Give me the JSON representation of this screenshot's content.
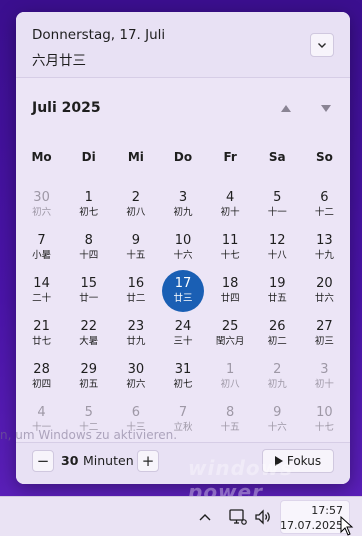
{
  "header": {
    "date": "Donnerstag, 17. Juli",
    "lunar": "六月廿三"
  },
  "calendar": {
    "month_label": "Juli 2025",
    "weekdays": [
      "Mo",
      "Di",
      "Mi",
      "Do",
      "Fr",
      "Sa",
      "So"
    ],
    "days": [
      {
        "n": "30",
        "l": "初六",
        "other": true
      },
      {
        "n": "1",
        "l": "初七"
      },
      {
        "n": "2",
        "l": "初八"
      },
      {
        "n": "3",
        "l": "初九"
      },
      {
        "n": "4",
        "l": "初十"
      },
      {
        "n": "5",
        "l": "十一"
      },
      {
        "n": "6",
        "l": "十二"
      },
      {
        "n": "7",
        "l": "小暑"
      },
      {
        "n": "8",
        "l": "十四"
      },
      {
        "n": "9",
        "l": "十五"
      },
      {
        "n": "10",
        "l": "十六"
      },
      {
        "n": "11",
        "l": "十七"
      },
      {
        "n": "12",
        "l": "十八"
      },
      {
        "n": "13",
        "l": "十九"
      },
      {
        "n": "14",
        "l": "二十"
      },
      {
        "n": "15",
        "l": "廿一"
      },
      {
        "n": "16",
        "l": "廿二"
      },
      {
        "n": "17",
        "l": "廿三",
        "today": true
      },
      {
        "n": "18",
        "l": "廿四"
      },
      {
        "n": "19",
        "l": "廿五"
      },
      {
        "n": "20",
        "l": "廿六"
      },
      {
        "n": "21",
        "l": "廿七"
      },
      {
        "n": "22",
        "l": "大暑"
      },
      {
        "n": "23",
        "l": "廿九"
      },
      {
        "n": "24",
        "l": "三十"
      },
      {
        "n": "25",
        "l": "閏六月"
      },
      {
        "n": "26",
        "l": "初二"
      },
      {
        "n": "27",
        "l": "初三"
      },
      {
        "n": "28",
        "l": "初四"
      },
      {
        "n": "29",
        "l": "初五"
      },
      {
        "n": "30",
        "l": "初六"
      },
      {
        "n": "31",
        "l": "初七"
      },
      {
        "n": "1",
        "l": "初八",
        "other": true
      },
      {
        "n": "2",
        "l": "初九",
        "other": true
      },
      {
        "n": "3",
        "l": "初十",
        "other": true
      },
      {
        "n": "4",
        "l": "十一",
        "other": true
      },
      {
        "n": "5",
        "l": "十二",
        "other": true
      },
      {
        "n": "6",
        "l": "十三",
        "other": true
      },
      {
        "n": "7",
        "l": "立秋",
        "other": true
      },
      {
        "n": "8",
        "l": "十五",
        "other": true
      },
      {
        "n": "9",
        "l": "十六",
        "other": true
      },
      {
        "n": "10",
        "l": "十七",
        "other": true
      }
    ]
  },
  "focus": {
    "minus_label": "−",
    "minutes_value": "30",
    "minutes_unit": "Minuten",
    "plus_label": "+",
    "focus_button_label": "Fokus"
  },
  "watermark": {
    "activation_text": "n, um Windows zu aktivieren.",
    "logo_text": "windows-power"
  },
  "taskbar": {
    "time": "17:57",
    "date": "17.07.2025"
  },
  "colors": {
    "accent": "#1a5fb4",
    "desktop": "#41109a",
    "flyout": "#ede6f7"
  }
}
